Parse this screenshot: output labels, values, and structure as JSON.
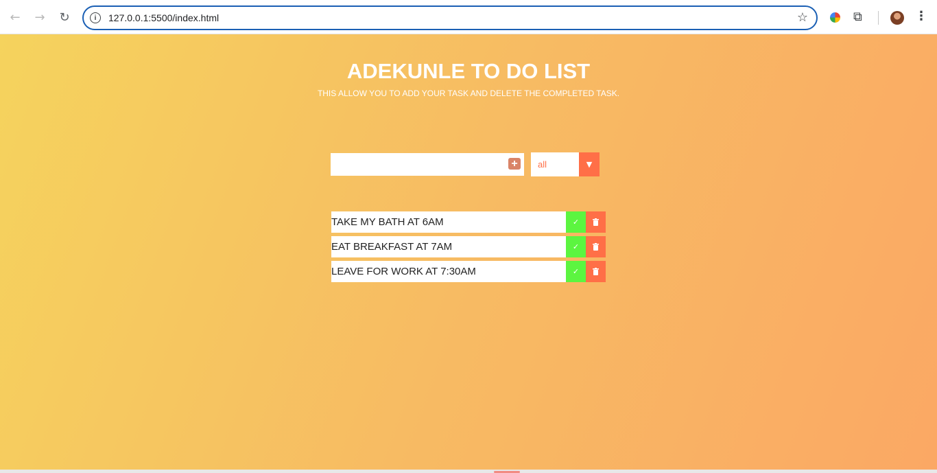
{
  "browser": {
    "back_icon": "←",
    "forward_icon": "→",
    "reload_icon": "↻",
    "info_icon": "i",
    "url": "127.0.0.1:5500/index.html",
    "star_icon": "☆",
    "puzzle_icon": "⧉",
    "menu_icon": "⋮"
  },
  "page": {
    "title": "ADEKUNLE TO DO LIST",
    "subtitle": "THIS ALLOW YOU TO ADD YOUR TASK AND DELETE THE COMPLETED TASK.",
    "input": {
      "value": "",
      "placeholder": ""
    },
    "add_icon": "+",
    "filter": {
      "value": "all",
      "caret": "▼"
    },
    "todos": [
      {
        "text": "TAKE MY BATH AT 6AM"
      },
      {
        "text": "EAT BREAKFAST AT 7AM"
      },
      {
        "text": "LEAVE FOR WORK AT 7:30AM"
      }
    ],
    "check_icon": "✓"
  },
  "colors": {
    "gradient_start": "#f5d35d",
    "gradient_end": "#fba864",
    "accent": "#ff6f47",
    "complete_green": "#5cf540",
    "url_focus": "#1a5fb4"
  }
}
